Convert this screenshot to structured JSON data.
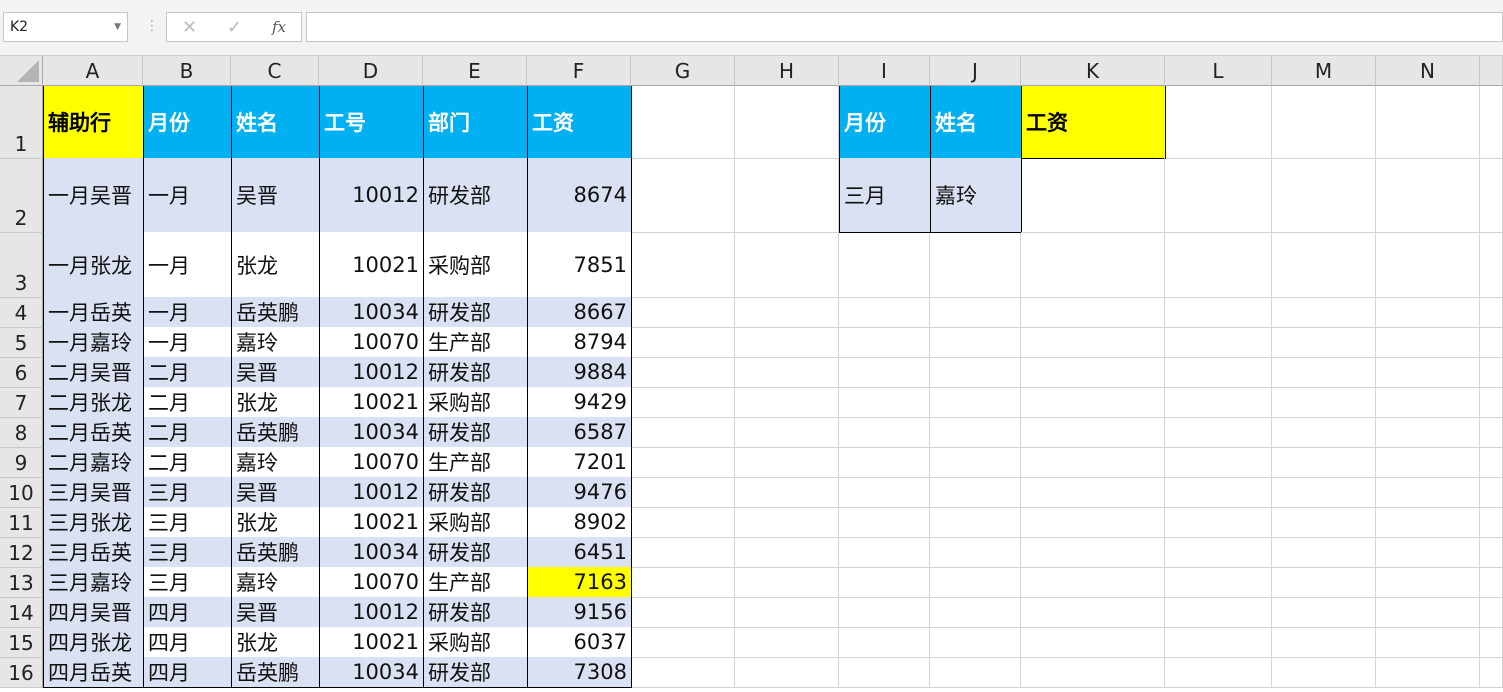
{
  "name_box": "K2",
  "formula_bar": {
    "cancel_icon": "✕",
    "enter_icon": "✓",
    "fx_label": "fx",
    "value": ""
  },
  "columns": [
    "A",
    "B",
    "C",
    "D",
    "E",
    "F",
    "G",
    "H",
    "I",
    "J",
    "K",
    "L",
    "M",
    "N"
  ],
  "colors": {
    "header_blue": "#00b0f0",
    "helper_yellow": "#ffff00",
    "row_fill": "#d9e1f2"
  },
  "table": {
    "headers": [
      "辅助行",
      "月份",
      "姓名",
      "工号",
      "部门",
      "工资"
    ],
    "rows": [
      [
        "一月吴晋",
        "一月",
        "吴晋",
        "10012",
        "研发部",
        "8674"
      ],
      [
        "一月张龙",
        "一月",
        "张龙",
        "10021",
        "采购部",
        "7851"
      ],
      [
        "一月岳英",
        "一月",
        "岳英鹏",
        "10034",
        "研发部",
        "8667"
      ],
      [
        "一月嘉玲",
        "一月",
        "嘉玲",
        "10070",
        "生产部",
        "8794"
      ],
      [
        "二月吴晋",
        "二月",
        "吴晋",
        "10012",
        "研发部",
        "9884"
      ],
      [
        "二月张龙",
        "二月",
        "张龙",
        "10021",
        "采购部",
        "9429"
      ],
      [
        "二月岳英",
        "二月",
        "岳英鹏",
        "10034",
        "研发部",
        "6587"
      ],
      [
        "二月嘉玲",
        "二月",
        "嘉玲",
        "10070",
        "生产部",
        "7201"
      ],
      [
        "三月吴晋",
        "三月",
        "吴晋",
        "10012",
        "研发部",
        "9476"
      ],
      [
        "三月张龙",
        "三月",
        "张龙",
        "10021",
        "采购部",
        "8902"
      ],
      [
        "三月岳英",
        "三月",
        "岳英鹏",
        "10034",
        "研发部",
        "6451"
      ],
      [
        "三月嘉玲",
        "三月",
        "嘉玲",
        "10070",
        "生产部",
        "7163"
      ],
      [
        "四月吴晋",
        "四月",
        "吴晋",
        "10012",
        "研发部",
        "9156"
      ],
      [
        "四月张龙",
        "四月",
        "张龙",
        "10021",
        "采购部",
        "6037"
      ],
      [
        "四月岳英",
        "四月",
        "岳英鹏",
        "10034",
        "研发部",
        "7308"
      ]
    ]
  },
  "lookup": {
    "headers": [
      "月份",
      "姓名",
      "工资"
    ],
    "values": [
      "三月",
      "嘉玲",
      ""
    ]
  },
  "row_numbers": [
    "1",
    "2",
    "3",
    "4",
    "5",
    "6",
    "7",
    "8",
    "9",
    "10",
    "11",
    "12",
    "13",
    "14",
    "15",
    "16"
  ]
}
